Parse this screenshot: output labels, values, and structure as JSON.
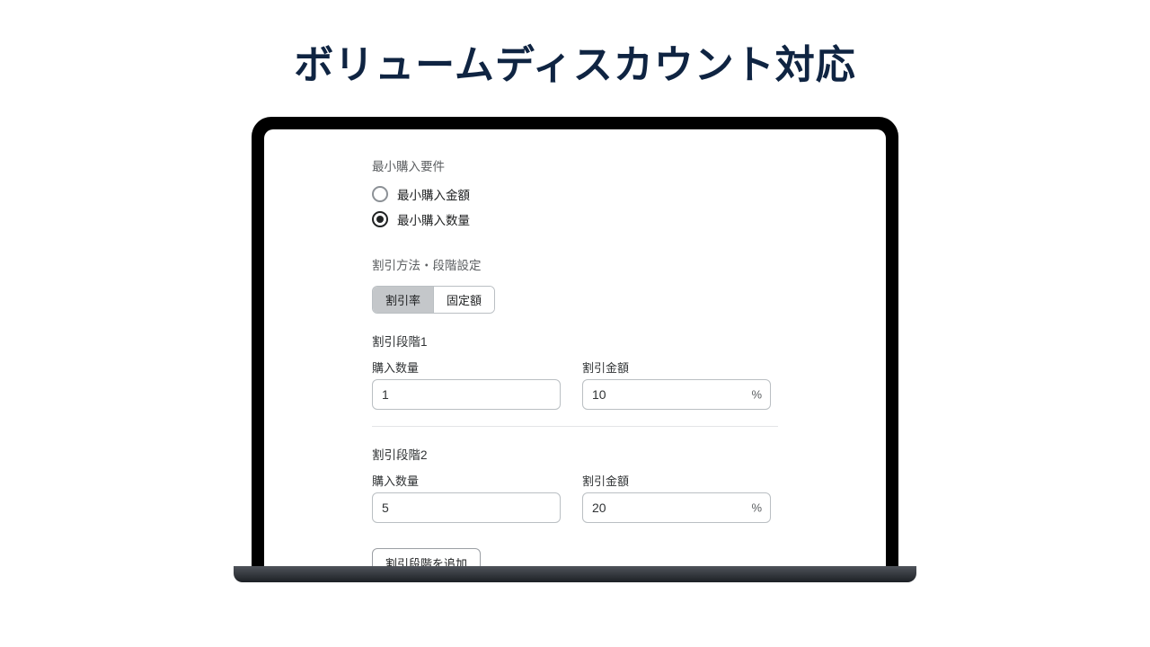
{
  "pageTitle": "ボリュームディスカウント対応",
  "minRequirement": {
    "heading": "最小購入要件",
    "options": {
      "amount": "最小購入金額",
      "quantity": "最小購入数量"
    },
    "selected": "quantity"
  },
  "discountMethod": {
    "heading": "割引方法・段階設定",
    "segments": {
      "percent": "割引率",
      "fixed": "固定額"
    },
    "active": "percent"
  },
  "tierLabels": {
    "quantity": "購入数量",
    "amount": "割引金額",
    "suffix": "%"
  },
  "tiers": [
    {
      "title": "割引段階1",
      "quantity": "1",
      "amount": "10"
    },
    {
      "title": "割引段階2",
      "quantity": "5",
      "amount": "20"
    }
  ],
  "addTierButton": "割引段階を追加"
}
